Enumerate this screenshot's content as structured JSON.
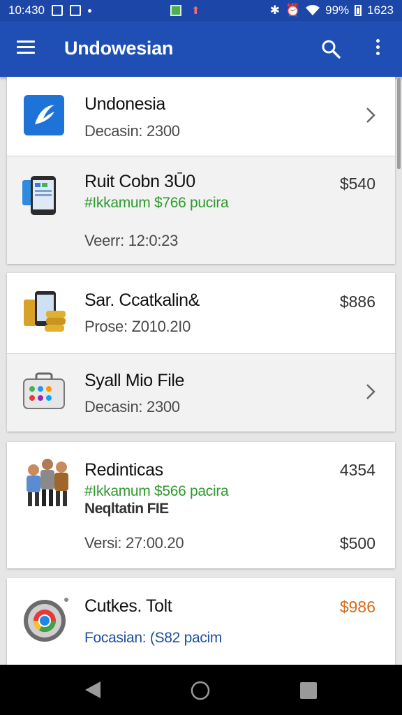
{
  "status": {
    "time": "10:430",
    "battery": "99%",
    "clock_right": "1623"
  },
  "app_bar": {
    "title": "Undowesian"
  },
  "items": [
    {
      "title": "Undonesia",
      "sub": "Decasin: 2300"
    },
    {
      "title": "Ruit Cobn 3Ū0",
      "green": "#Ikkamum $766 pucira",
      "sub": "Veerr: 12:0:23",
      "price": "$540"
    },
    {
      "title": "Sar. Ccatkalin&",
      "sub": "Prose: Z010.2I0",
      "price": "$886"
    },
    {
      "title": "Syall Mio File",
      "sub": "Decasin: 2300"
    },
    {
      "title": "Redinticas",
      "green": "#Ikkamum $566 pacira",
      "bold": "Neqltatin FIE",
      "sub": "Versi: 27:00.20",
      "price": "4354",
      "price2": "$500"
    },
    {
      "title": "Cutkes. Tolt",
      "blue": "Focasian: (S82 pacim",
      "price": "$986"
    }
  ],
  "colors": {
    "appbar": "#1f4fb5",
    "statusbar": "#1c47a8",
    "green_text": "#2e9a2e",
    "orange_price": "#d86a14"
  }
}
